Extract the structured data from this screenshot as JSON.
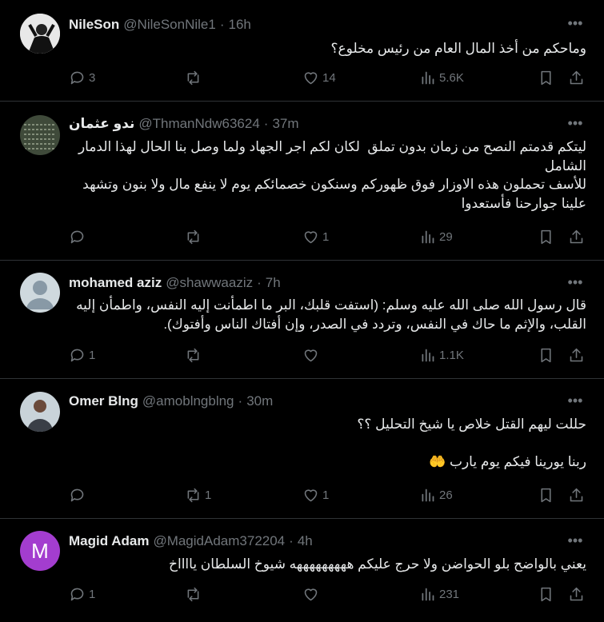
{
  "tweets": [
    {
      "name": "NileSon",
      "handle": "@NileSonNile1",
      "time": "16h",
      "text": "وماحكم من أخذ المال العام من رئيس مخلوع؟",
      "reply_count": "3",
      "retweet_count": "",
      "like_count": "14",
      "views": "5.6K"
    },
    {
      "name": "ندو عثمان",
      "handle": "@ThmanNdw63624",
      "time": "37m",
      "text": "ليتكم قدمتم النصح من زمان بدون تملق  لكان لكم اجر الجهاد ولما وصل بنا الحال لهذا الدمار الشامل\nللأسف تحملون هذه الاوزار فوق ظهوركم وسنكون خصمائكم يوم لا ينفع مال ولا بنون وتشهد علينا جوارحنا فأستعدوا",
      "reply_count": "",
      "retweet_count": "",
      "like_count": "1",
      "views": "29"
    },
    {
      "name": "mohamed aziz",
      "handle": "@shawwaaziz",
      "time": "7h",
      "text": "قال رسول الله صلى الله عليه وسلم: (استفت قلبك، البر ما اطمأنت إليه النفس، واطمأن إليه القلب، والإثم ما حاك في النفس، وتردد في الصدر، وإن أفتاك الناس وأفتوك).",
      "reply_count": "1",
      "retweet_count": "",
      "like_count": "",
      "views": "1.1K"
    },
    {
      "name": "Omer Blng",
      "handle": "@amoblngblng",
      "time": "30m",
      "text": "حللت ليهم القتل خلاص يا شيخ التحليل ؟؟\n\nربنا يورينا فيكم يوم يارب 🤲",
      "reply_count": "",
      "retweet_count": "1",
      "like_count": "1",
      "views": "26"
    },
    {
      "name": "Magid Adam",
      "handle": "@MagidAdam372204",
      "time": "4h",
      "text": "يعني بالواضح بلو الحواضن ولا حرج عليكم هههههههههه شيوخ السلطان يااااخ",
      "reply_count": "1",
      "retweet_count": "",
      "like_count": "",
      "views": "231",
      "avatar_letter": "M"
    }
  ],
  "more_glyph": "•••",
  "separator": "·",
  "icons": [
    "reply-icon",
    "retweet-icon",
    "like-icon",
    "views-icon",
    "bookmark-icon",
    "share-icon"
  ],
  "colors": {
    "background": "#000000",
    "text": "#e7e9ea",
    "muted": "#71767b",
    "border": "#2f3336",
    "m_avatar": "#a33dcf"
  }
}
